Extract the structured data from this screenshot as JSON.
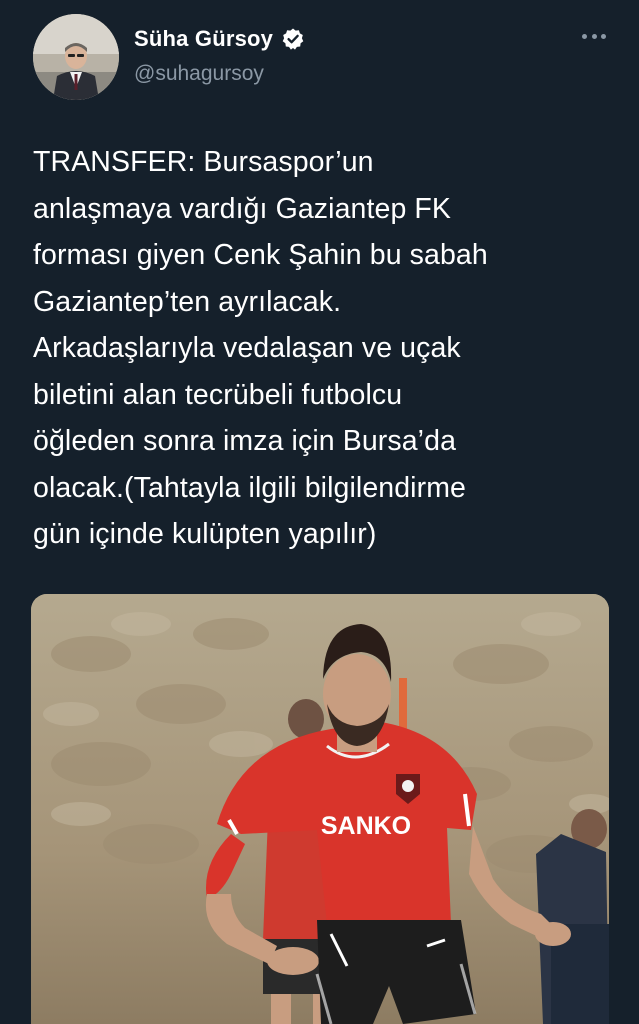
{
  "tweet": {
    "author": {
      "display_name": "Süha Gürsoy",
      "handle": "@suhagursoy",
      "verified": true,
      "avatar_icon": "author-avatar-photo"
    },
    "more_icon": "more-options-icon",
    "text": "TRANSFER: Bursaspor’un\nanlaşmaya vardığı Gaziantep FK\nforması giyen Cenk Şahin bu sabah\nGaziantep’ten ayrılacak.\nArkadaşlarıyla vedalaşan ve uçak\nbiletini alan tecrübeli futbolcu\nöğleden sonra imza için Bursa’da\nolacak.(Tahtayla ilgili bilgilendirme\ngün içinde kulüpten yapılır)",
    "media": {
      "jersey_sponsor": "SANKO",
      "description_icon": "footballer-training-photo"
    }
  },
  "colors": {
    "background": "#15202b",
    "secondary_text": "#8b98a5",
    "verified_badge": "#ffffff",
    "jersey_red": "#d9342b"
  }
}
